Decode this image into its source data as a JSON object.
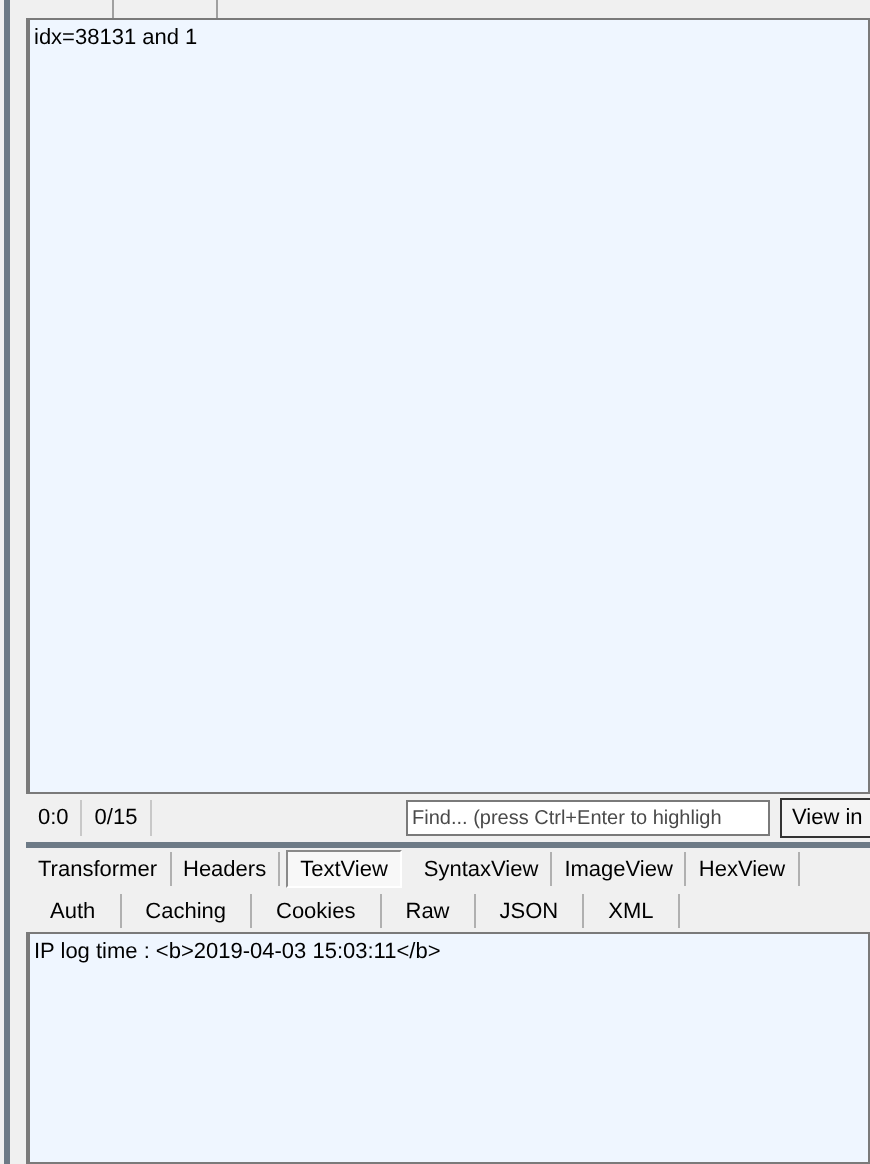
{
  "request": {
    "body": "idx=38131 and 1"
  },
  "status_bar": {
    "position": "0:0",
    "count": "0/15",
    "find": {
      "placeholder": "Find... (press Ctrl+Enter to highligh"
    },
    "button": "View in"
  },
  "tabs_row_1": [
    {
      "label": "Transformer",
      "selected": false
    },
    {
      "label": "Headers",
      "selected": false
    },
    {
      "label": "TextView",
      "selected": true
    },
    {
      "label": "SyntaxView",
      "selected": false
    },
    {
      "label": "ImageView",
      "selected": false
    },
    {
      "label": "HexView",
      "selected": false
    }
  ],
  "tabs_row_2": [
    {
      "label": "Auth",
      "selected": false
    },
    {
      "label": "Caching",
      "selected": false
    },
    {
      "label": "Cookies",
      "selected": false
    },
    {
      "label": "Raw",
      "selected": false
    },
    {
      "label": "JSON",
      "selected": false
    },
    {
      "label": "XML",
      "selected": false
    }
  ],
  "response": {
    "body": "IP log time : <b>2019-04-03 15:03:11</b>"
  }
}
